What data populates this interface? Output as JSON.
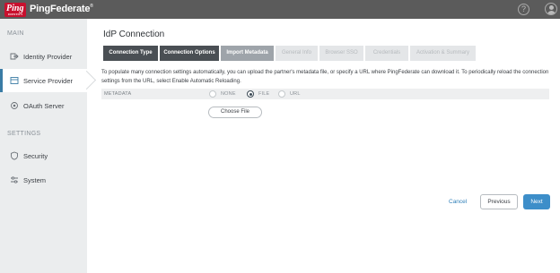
{
  "header": {
    "logo_text": "Ping",
    "logo_subtext": "IDENTITY",
    "brand": "PingFederate",
    "brand_mark": "®",
    "help_glyph": "?"
  },
  "sidebar": {
    "main_heading": "MAIN",
    "settings_heading": "SETTINGS",
    "items": [
      {
        "label": "Identity Provider",
        "icon": "identity-provider-icon"
      },
      {
        "label": "Service Provider",
        "icon": "service-provider-icon",
        "active": true
      },
      {
        "label": "OAuth Server",
        "icon": "oauth-icon"
      },
      {
        "label": "Security",
        "icon": "security-icon"
      },
      {
        "label": "System",
        "icon": "system-icon"
      }
    ]
  },
  "main": {
    "title": "IdP Connection",
    "tabs": [
      {
        "label": "Connection Type",
        "state": "done"
      },
      {
        "label": "Connection Options",
        "state": "done"
      },
      {
        "label": "Import Metadata",
        "state": "current"
      },
      {
        "label": "General Info",
        "state": "todo"
      },
      {
        "label": "Browser SSO",
        "state": "todo"
      },
      {
        "label": "Credentials",
        "state": "todo"
      },
      {
        "label": "Activation & Summary",
        "state": "todo"
      }
    ],
    "description": "To populate many connection settings automatically, you can upload the partner's metadata file, or specify a URL where PingFederate can download it. To periodically reload the connection settings from the URL, select Enable Automatic Reloading.",
    "metadata": {
      "label": "METADATA",
      "options": [
        "NONE",
        "FILE",
        "URL"
      ],
      "selected": "FILE"
    },
    "choose_file": "Choose File"
  },
  "footer": {
    "cancel": "Cancel",
    "previous": "Previous",
    "next": "Next"
  },
  "colors": {
    "topbar": "#5b5b5b",
    "brand_red": "#c8102e",
    "accent_blue": "#3d8ec9",
    "tab_done": "#4a4f54"
  }
}
